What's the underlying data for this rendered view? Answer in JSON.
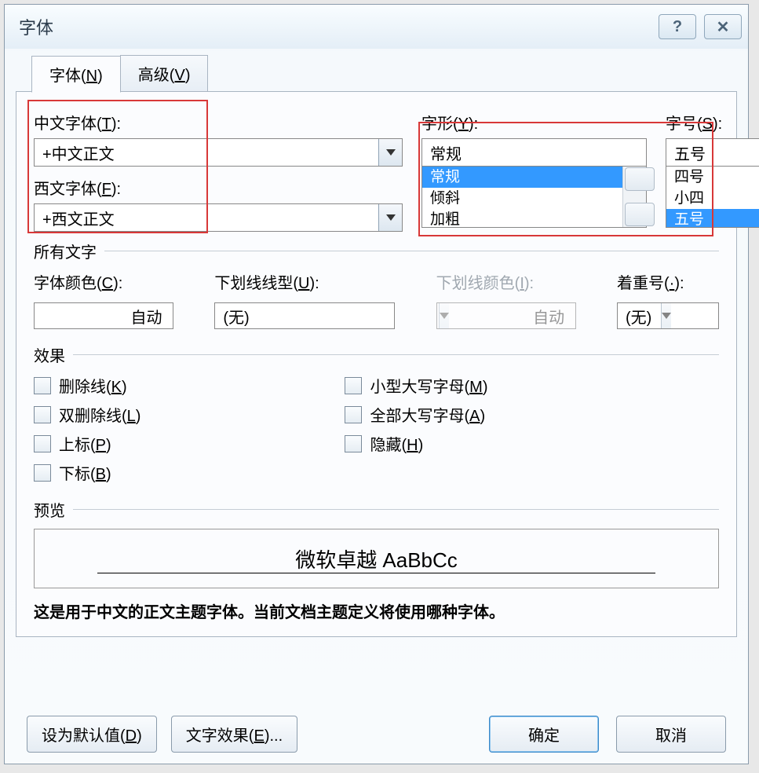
{
  "dialog": {
    "title": "字体",
    "help_label": "?",
    "close_label": "✕"
  },
  "tabs": {
    "font": {
      "prefix": "字体(",
      "key": "N",
      "suffix": ")"
    },
    "advanced": {
      "prefix": "高级(",
      "key": "V",
      "suffix": ")"
    }
  },
  "fonts": {
    "chinese_label": {
      "prefix": "中文字体(",
      "key": "T",
      "suffix": "):"
    },
    "chinese_value": "+中文正文",
    "western_label": {
      "prefix": "西文字体(",
      "key": "F",
      "suffix": "):"
    },
    "western_value": "+西文正文"
  },
  "style": {
    "label": {
      "prefix": "字形(",
      "key": "Y",
      "suffix": "):"
    },
    "value": "常规",
    "options": [
      "常规",
      "倾斜",
      "加粗"
    ],
    "selected_index": 0
  },
  "size": {
    "label": {
      "prefix": "字号(",
      "key": "S",
      "suffix": "):"
    },
    "value": "五号",
    "options": [
      "四号",
      "小四",
      "五号"
    ],
    "selected_index": 2
  },
  "all_text_label": "所有文字",
  "font_color": {
    "label": {
      "prefix": "字体颜色(",
      "key": "C",
      "suffix": "):"
    },
    "value": "自动"
  },
  "underline_style": {
    "label": {
      "prefix": "下划线线型(",
      "key": "U",
      "suffix": "):"
    },
    "value": "(无)"
  },
  "underline_color": {
    "label": {
      "prefix": "下划线颜色(",
      "key": "I",
      "suffix": "):"
    },
    "value": "自动"
  },
  "emphasis": {
    "label": {
      "prefix": "着重号(",
      "key": "·",
      "suffix": "):"
    },
    "value": "(无)"
  },
  "effects_label": "效果",
  "effects": {
    "strike": {
      "prefix": "删除线(",
      "key": "K",
      "suffix": ")"
    },
    "double_strike": {
      "prefix": "双删除线(",
      "key": "L",
      "suffix": ")"
    },
    "superscript": {
      "prefix": "上标(",
      "key": "P",
      "suffix": ")"
    },
    "subscript": {
      "prefix": "下标(",
      "key": "B",
      "suffix": ")"
    },
    "small_caps": {
      "prefix": "小型大写字母(",
      "key": "M",
      "suffix": ")"
    },
    "all_caps": {
      "prefix": "全部大写字母(",
      "key": "A",
      "suffix": ")"
    },
    "hidden": {
      "prefix": "隐藏(",
      "key": "H",
      "suffix": ")"
    }
  },
  "preview_label": "预览",
  "preview_text": "微软卓越  AaBbCc",
  "description": "这是用于中文的正文主题字体。当前文档主题定义将使用哪种字体。",
  "buttons": {
    "set_default": {
      "prefix": "设为默认值(",
      "key": "D",
      "suffix": ")"
    },
    "text_effects": {
      "prefix": "文字效果(",
      "key": "E",
      "suffix": ")..."
    },
    "ok": "确定",
    "cancel": "取消"
  }
}
